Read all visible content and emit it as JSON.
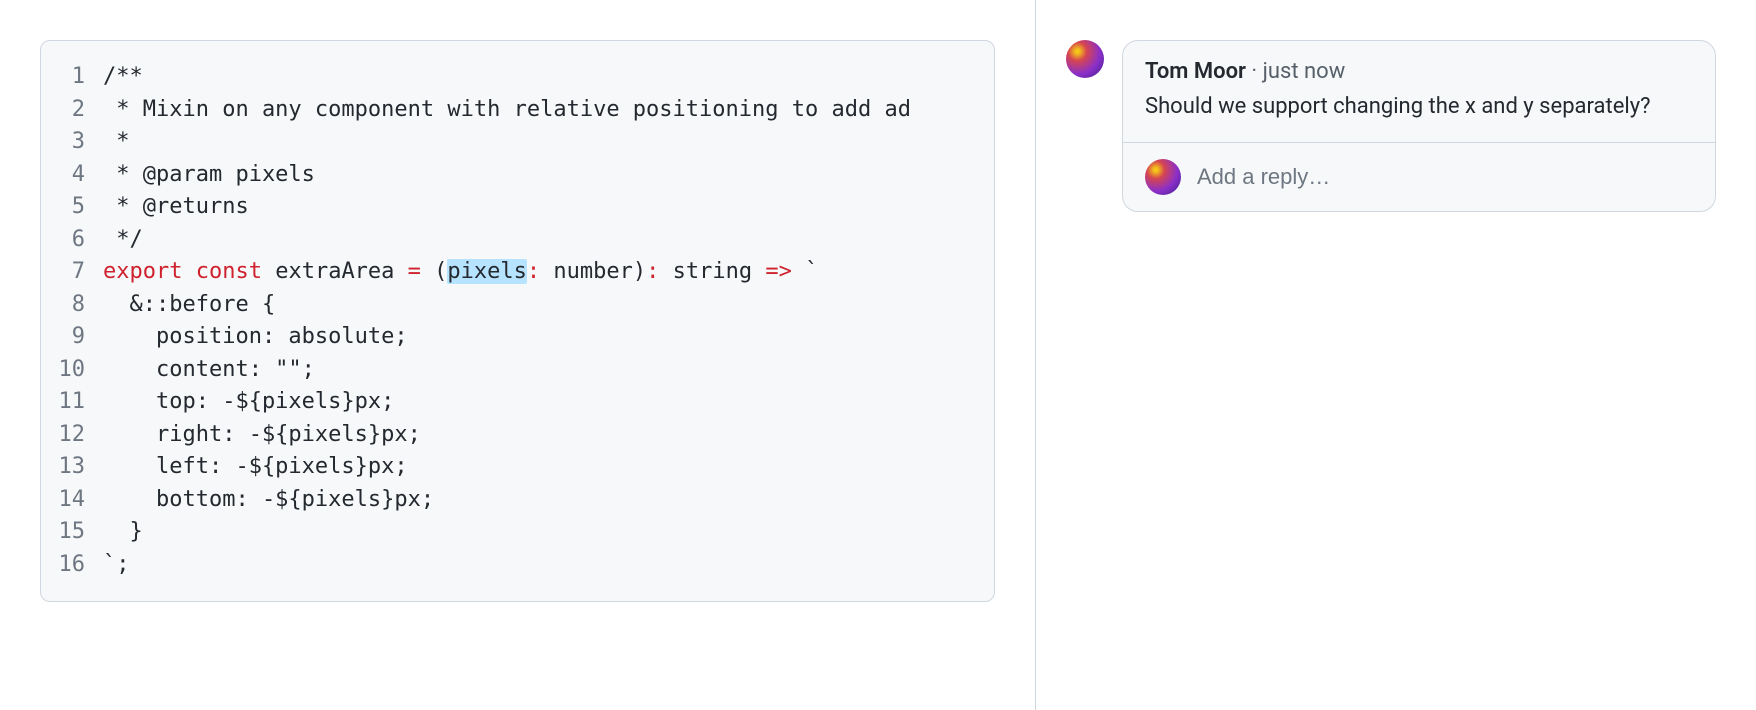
{
  "code": {
    "lines": [
      {
        "n": "1",
        "segments": [
          {
            "cls": "tok-comment",
            "text": "/**"
          }
        ]
      },
      {
        "n": "2",
        "segments": [
          {
            "cls": "tok-comment",
            "text": " * Mixin on any component with relative positioning to add ad"
          }
        ]
      },
      {
        "n": "3",
        "segments": [
          {
            "cls": "tok-comment",
            "text": " *"
          }
        ]
      },
      {
        "n": "4",
        "segments": [
          {
            "cls": "tok-comment",
            "text": " * @param pixels"
          }
        ]
      },
      {
        "n": "5",
        "segments": [
          {
            "cls": "tok-comment",
            "text": " * @returns"
          }
        ]
      },
      {
        "n": "6",
        "segments": [
          {
            "cls": "tok-comment",
            "text": " */"
          }
        ]
      },
      {
        "n": "7",
        "segments": [
          {
            "cls": "tok-keyword",
            "text": "export"
          },
          {
            "cls": "",
            "text": " "
          },
          {
            "cls": "tok-keyword",
            "text": "const"
          },
          {
            "cls": "",
            "text": " extraArea "
          },
          {
            "cls": "tok-op-red",
            "text": "="
          },
          {
            "cls": "",
            "text": " ("
          },
          {
            "cls": "tok-highlight",
            "text": "pixels"
          },
          {
            "cls": "tok-op-red",
            "text": ":"
          },
          {
            "cls": "",
            "text": " number)"
          },
          {
            "cls": "tok-op-red",
            "text": ":"
          },
          {
            "cls": "",
            "text": " string "
          },
          {
            "cls": "tok-op-red",
            "text": "=>"
          },
          {
            "cls": "",
            "text": " `"
          }
        ]
      },
      {
        "n": "8",
        "segments": [
          {
            "cls": "",
            "text": "  &::before {"
          }
        ]
      },
      {
        "n": "9",
        "segments": [
          {
            "cls": "",
            "text": "    position: absolute;"
          }
        ]
      },
      {
        "n": "10",
        "segments": [
          {
            "cls": "",
            "text": "    content: \"\";"
          }
        ]
      },
      {
        "n": "11",
        "segments": [
          {
            "cls": "",
            "text": "    top: -${pixels}px;"
          }
        ]
      },
      {
        "n": "12",
        "segments": [
          {
            "cls": "",
            "text": "    right: -${pixels}px;"
          }
        ]
      },
      {
        "n": "13",
        "segments": [
          {
            "cls": "",
            "text": "    left: -${pixels}px;"
          }
        ]
      },
      {
        "n": "14",
        "segments": [
          {
            "cls": "",
            "text": "    bottom: -${pixels}px;"
          }
        ]
      },
      {
        "n": "15",
        "segments": [
          {
            "cls": "",
            "text": "  }"
          }
        ]
      },
      {
        "n": "16",
        "segments": [
          {
            "cls": "",
            "text": "`;"
          }
        ]
      }
    ]
  },
  "comment": {
    "author": "Tom Moor",
    "separator": " · ",
    "time": "just now",
    "text": "Should we support changing the x and y separately?"
  },
  "reply": {
    "placeholder": "Add a reply…"
  }
}
